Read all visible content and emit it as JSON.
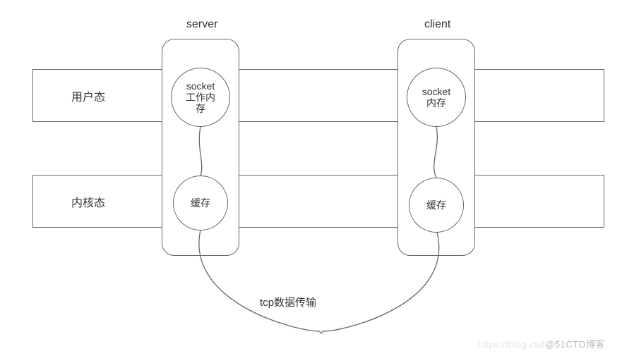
{
  "titles": {
    "server": "server",
    "client": "client"
  },
  "rows": {
    "user": "用户态",
    "kernel": "内核态"
  },
  "server": {
    "socket": "socket\n工作内\n存",
    "cache": "缓存"
  },
  "client": {
    "socket": "socket\n内存",
    "cache": "缓存"
  },
  "transport": "tcp数据传输",
  "watermark": {
    "faint": "https://blog.csd",
    "strong": "@51CTO博客"
  }
}
